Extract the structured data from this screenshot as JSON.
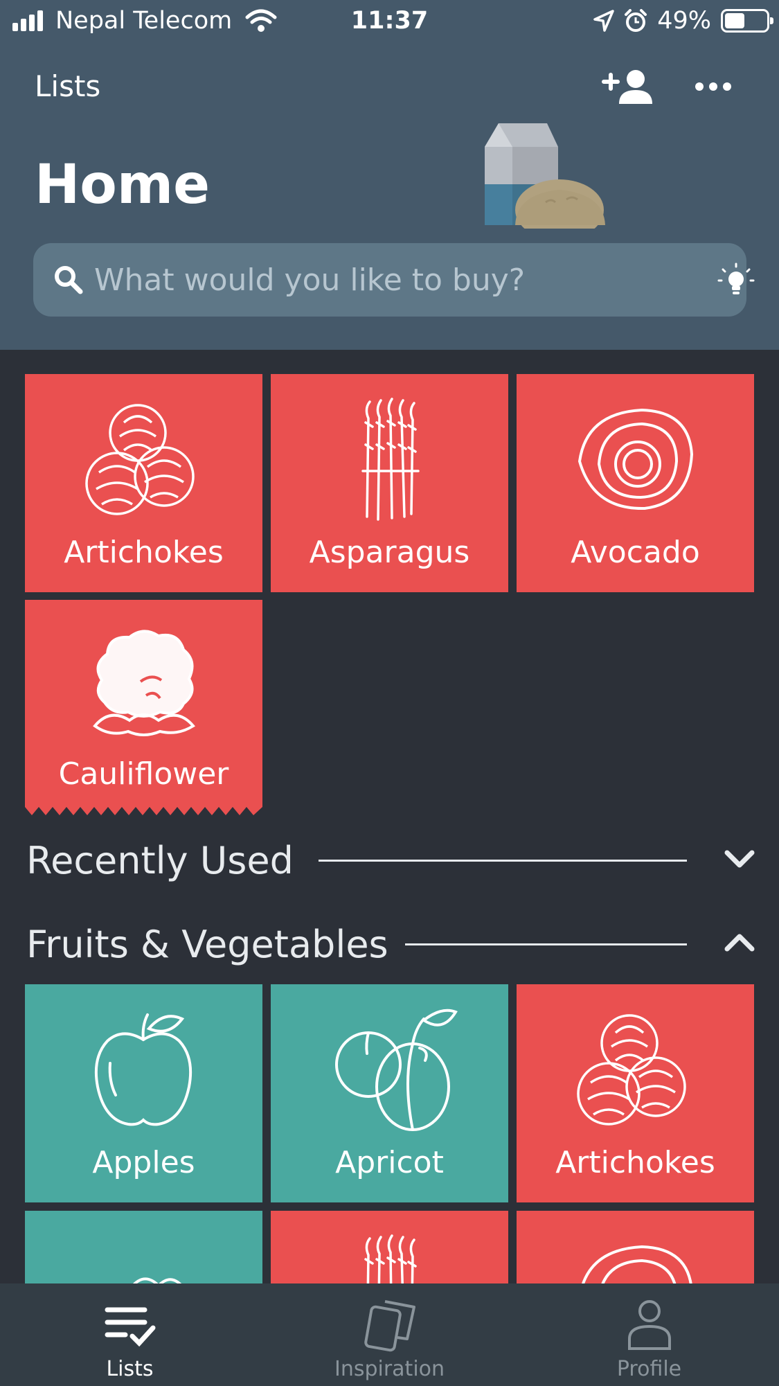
{
  "status_bar": {
    "carrier": "Nepal Telecom",
    "time": "11:37",
    "battery": "49%",
    "battery_level": 0.49
  },
  "header": {
    "nav_title": "Lists",
    "page_title": "Home",
    "search_placeholder": "What would you like to buy?"
  },
  "top_items": [
    {
      "label": "Artichokes",
      "color": "#ea5050",
      "icon": "artichoke-icon"
    },
    {
      "label": "Asparagus",
      "color": "#ea5050",
      "icon": "asparagus-icon"
    },
    {
      "label": "Avocado",
      "color": "#ea5050",
      "icon": "avocado-icon"
    },
    {
      "label": "Cauliflower",
      "color": "#ea5050",
      "icon": "cauliflower-icon"
    }
  ],
  "sections": [
    {
      "name": "Recently Used",
      "state": "collapsed"
    },
    {
      "name": "Fruits & Vegetables",
      "state": "expanded"
    }
  ],
  "fruit_items": [
    {
      "label": "Apples",
      "color": "#4aa9a0",
      "icon": "apple-icon"
    },
    {
      "label": "Apricot",
      "color": "#4aa9a0",
      "icon": "apricot-icon"
    },
    {
      "label": "Artichokes",
      "color": "#ea5050",
      "icon": "artichoke-icon"
    },
    {
      "label": "",
      "color": "#4aa9a0",
      "icon": "leafy-greens-icon"
    },
    {
      "label": "",
      "color": "#ea5050",
      "icon": "asparagus-icon"
    },
    {
      "label": "",
      "color": "#ea5050",
      "icon": "avocado-icon"
    }
  ],
  "tabs": [
    {
      "label": "Lists",
      "icon": "list-check-icon",
      "active": true
    },
    {
      "label": "Inspiration",
      "icon": "cards-icon",
      "active": false
    },
    {
      "label": "Profile",
      "icon": "person-icon",
      "active": false
    }
  ],
  "colors": {
    "header_bg": "#45596a",
    "content_bg": "#2c3038",
    "red_tile": "#ea5050",
    "teal_tile": "#4aa9a0",
    "tabbar_bg": "#333d45"
  }
}
